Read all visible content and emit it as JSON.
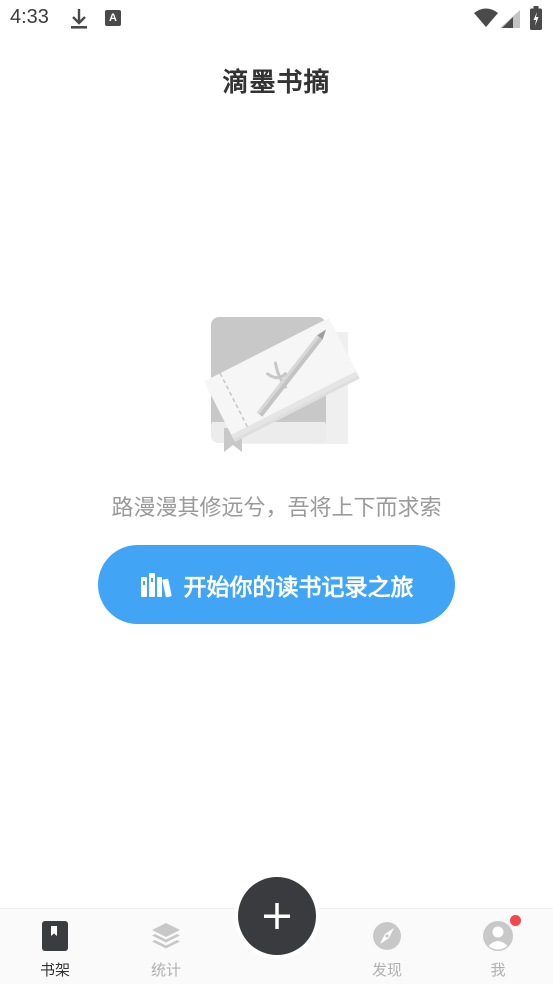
{
  "status_bar": {
    "time": "4:33",
    "icons": [
      "download-icon",
      "a-notification-icon",
      "wifi-icon",
      "signal-icon",
      "battery-icon"
    ]
  },
  "header": {
    "title": "滴墨书摘"
  },
  "empty_state": {
    "illustration": "book-and-pen-illustration",
    "slogan": "路漫漫其修远兮，吾将上下而求索",
    "button_label": "开始你的读书记录之旅",
    "button_icon": "books-icon",
    "button_color": "#42a4f5"
  },
  "bottom_nav": {
    "items": [
      {
        "label": "书架",
        "icon": "bookshelf-icon",
        "active": true
      },
      {
        "label": "统计",
        "icon": "layers-icon",
        "active": false
      },
      {
        "label": "发现",
        "icon": "compass-icon",
        "active": false
      },
      {
        "label": "我",
        "icon": "profile-icon",
        "active": false,
        "badge": true
      }
    ],
    "fab_icon": "plus-icon",
    "active_color": "#333333",
    "inactive_color": "#b0b0b0",
    "badge_color": "#f24848"
  }
}
